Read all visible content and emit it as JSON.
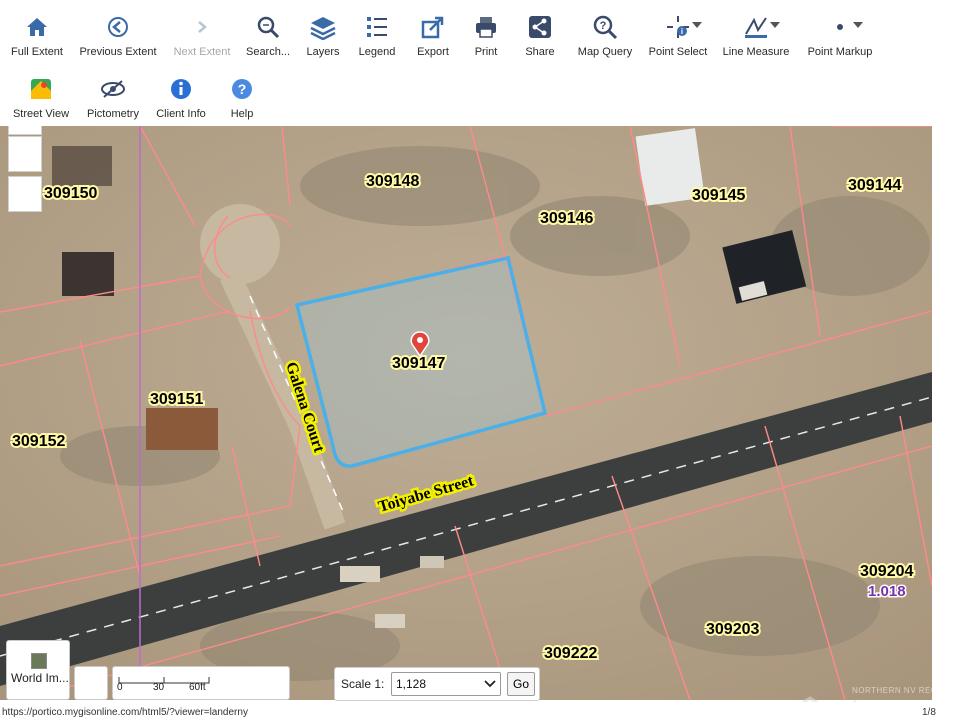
{
  "toolbar": {
    "full_extent": "Full Extent",
    "previous_extent": "Previous Extent",
    "next_extent": "Next Extent",
    "search": "Search...",
    "layers": "Layers",
    "legend": "Legend",
    "export": "Export",
    "print": "Print",
    "share": "Share",
    "map_query": "Map Query",
    "point_select": "Point Select",
    "line_measure": "Line Measure",
    "point_markup": "Point Markup",
    "street_view": "Street View",
    "pictometry": "Pictometry",
    "client_info": "Client Info",
    "help": "Help"
  },
  "map": {
    "parcels": {
      "p309150": "309150",
      "p309148": "309148",
      "p309146": "309146",
      "p309145": "309145",
      "p309144": "309144",
      "p309147": "309147",
      "p309151": "309151",
      "p309152": "309152",
      "p309204": "309204",
      "p309203": "309203",
      "p309222": "309222"
    },
    "acreage_309204": "1.018",
    "roads": {
      "galena": "Galena Court",
      "toiyabe": "Toiyabe Street"
    },
    "basemap_label": "World Im...",
    "scalebar_ticks": [
      "0",
      "30",
      "60ft"
    ]
  },
  "scale": {
    "label": "Scale 1:",
    "value": "1,128",
    "go": "Go"
  },
  "status": {
    "url": "https://portico.mygisonline.com/html5/?viewer=landerny",
    "page": "1/8",
    "watermark": "NORTHERN NV REGIONAL"
  },
  "colors": {
    "selected_parcel": "#4ab0e8",
    "parcel_lines": "#ff8a8a",
    "road_label_bg": "#f3f000"
  }
}
